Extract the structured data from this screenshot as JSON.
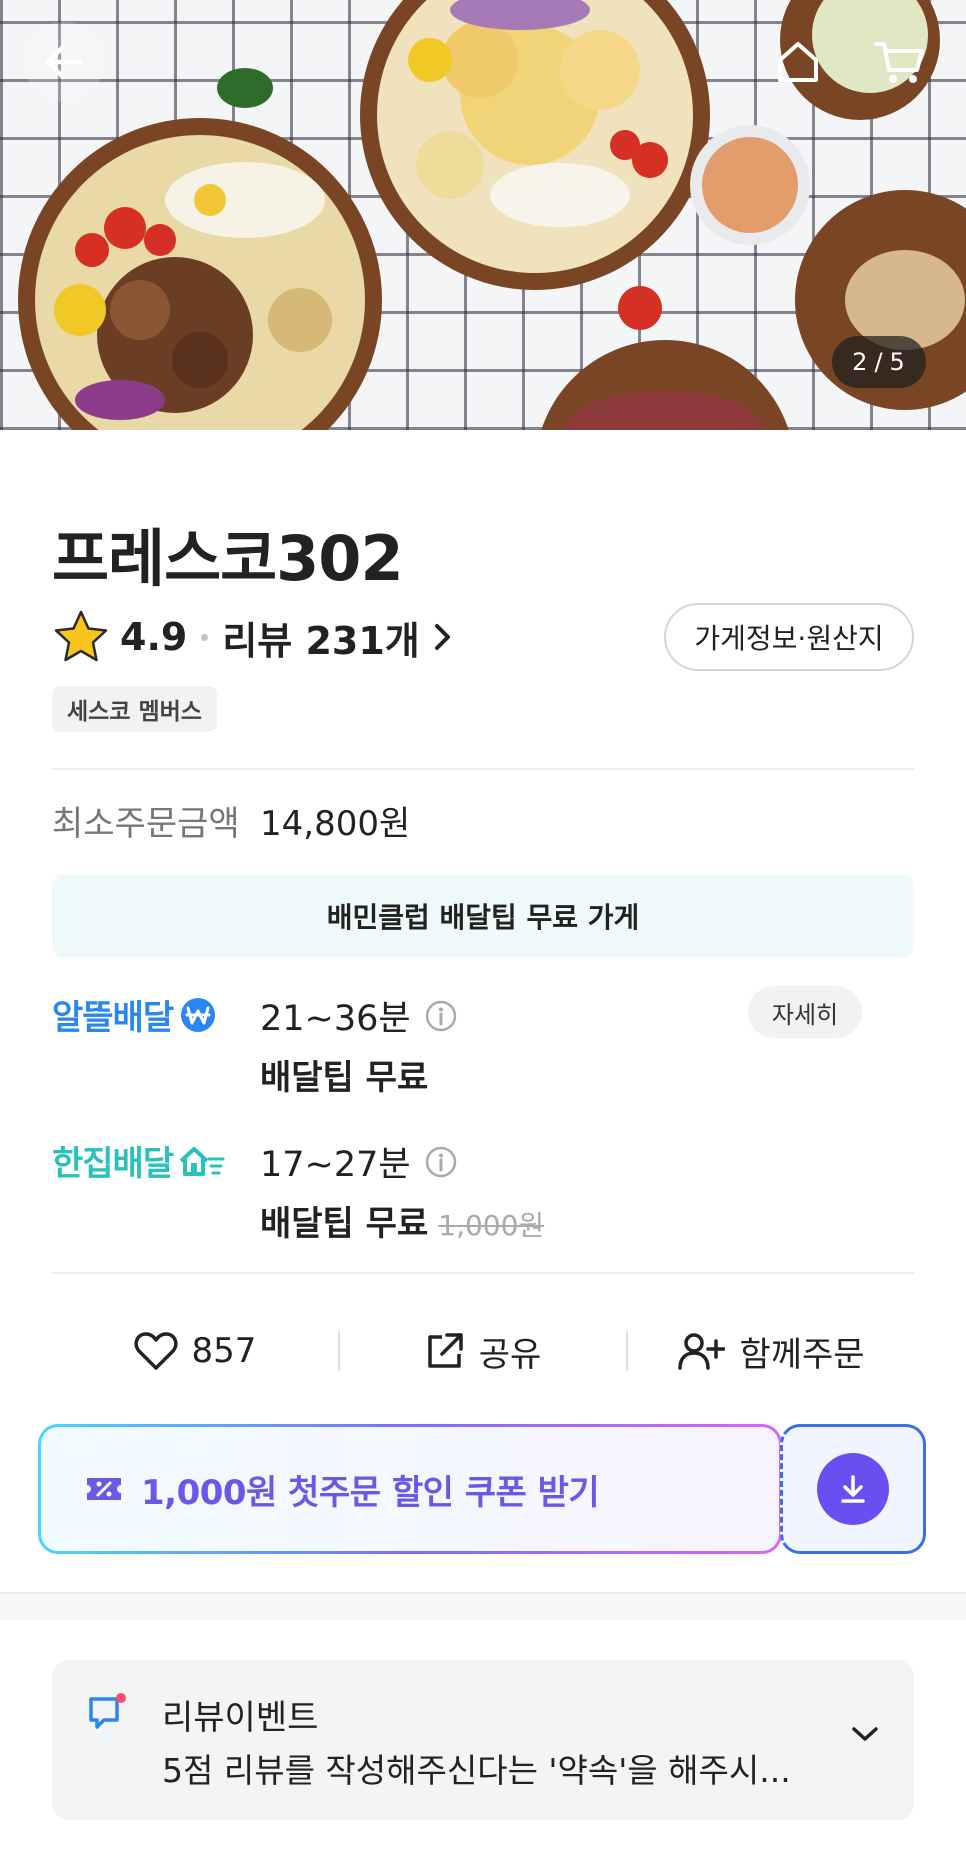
{
  "hero": {
    "photo_counter_current": "2",
    "photo_counter_sep": "/",
    "photo_counter_total": "5",
    "icons": [
      "arrow-left-icon",
      "home-icon",
      "cart-icon"
    ]
  },
  "store": {
    "name": "프레스코302",
    "rating": "4.9",
    "review_label": "리뷰 231개",
    "info_button": "가게정보·원산지",
    "member_badge": "세스코 멤버스"
  },
  "min_order": {
    "label": "최소주문금액",
    "value": "14,800원"
  },
  "club_banner": "배민클럽 배달팁 무료 가게",
  "delivery": {
    "detail_button": "자세히",
    "options": [
      {
        "brand": "알뜰배달",
        "time": "21~36분",
        "tip": "배달팁 무료",
        "color": "#2a87f2"
      },
      {
        "brand": "한집배달",
        "time": "17~27분",
        "tip": "배달팁 무료",
        "old_tip": "1,000원",
        "color": "#2ac1bc"
      }
    ]
  },
  "actions": {
    "like_count": "857",
    "share_label": "공유",
    "group_order_label": "함께주문"
  },
  "coupon": {
    "label": "1,000원 첫주문 할인 쿠폰 받기",
    "accent": "#6b58e6"
  },
  "event": {
    "title": "리뷰이벤트",
    "description": "5점 리뷰를 작성해주신다는 '약속'을 해주시..."
  }
}
